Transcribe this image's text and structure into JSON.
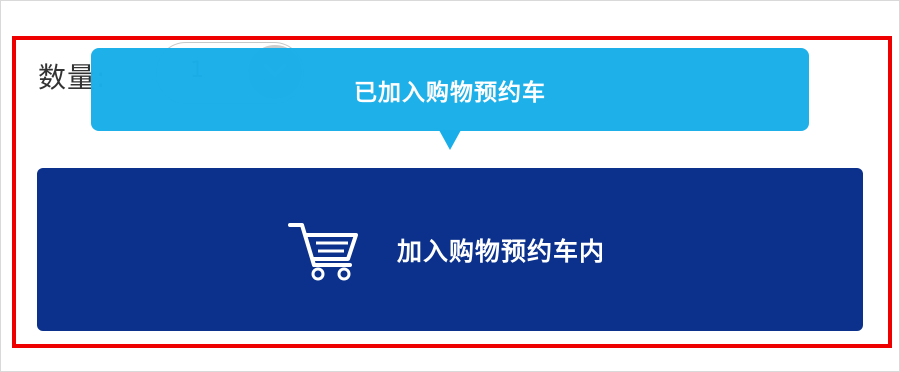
{
  "quantity": {
    "label": "数量:",
    "value": "1"
  },
  "tooltip": {
    "text": "已加入购物预约车"
  },
  "cart_button": {
    "label": "加入购物预约车内"
  },
  "colors": {
    "highlight_border": "#ee0000",
    "tooltip_bg": "#19aee9",
    "button_bg": "#0b318c"
  },
  "icons": {
    "cart": "shopping-cart-icon",
    "dropdown": "chevron-down-icon"
  }
}
